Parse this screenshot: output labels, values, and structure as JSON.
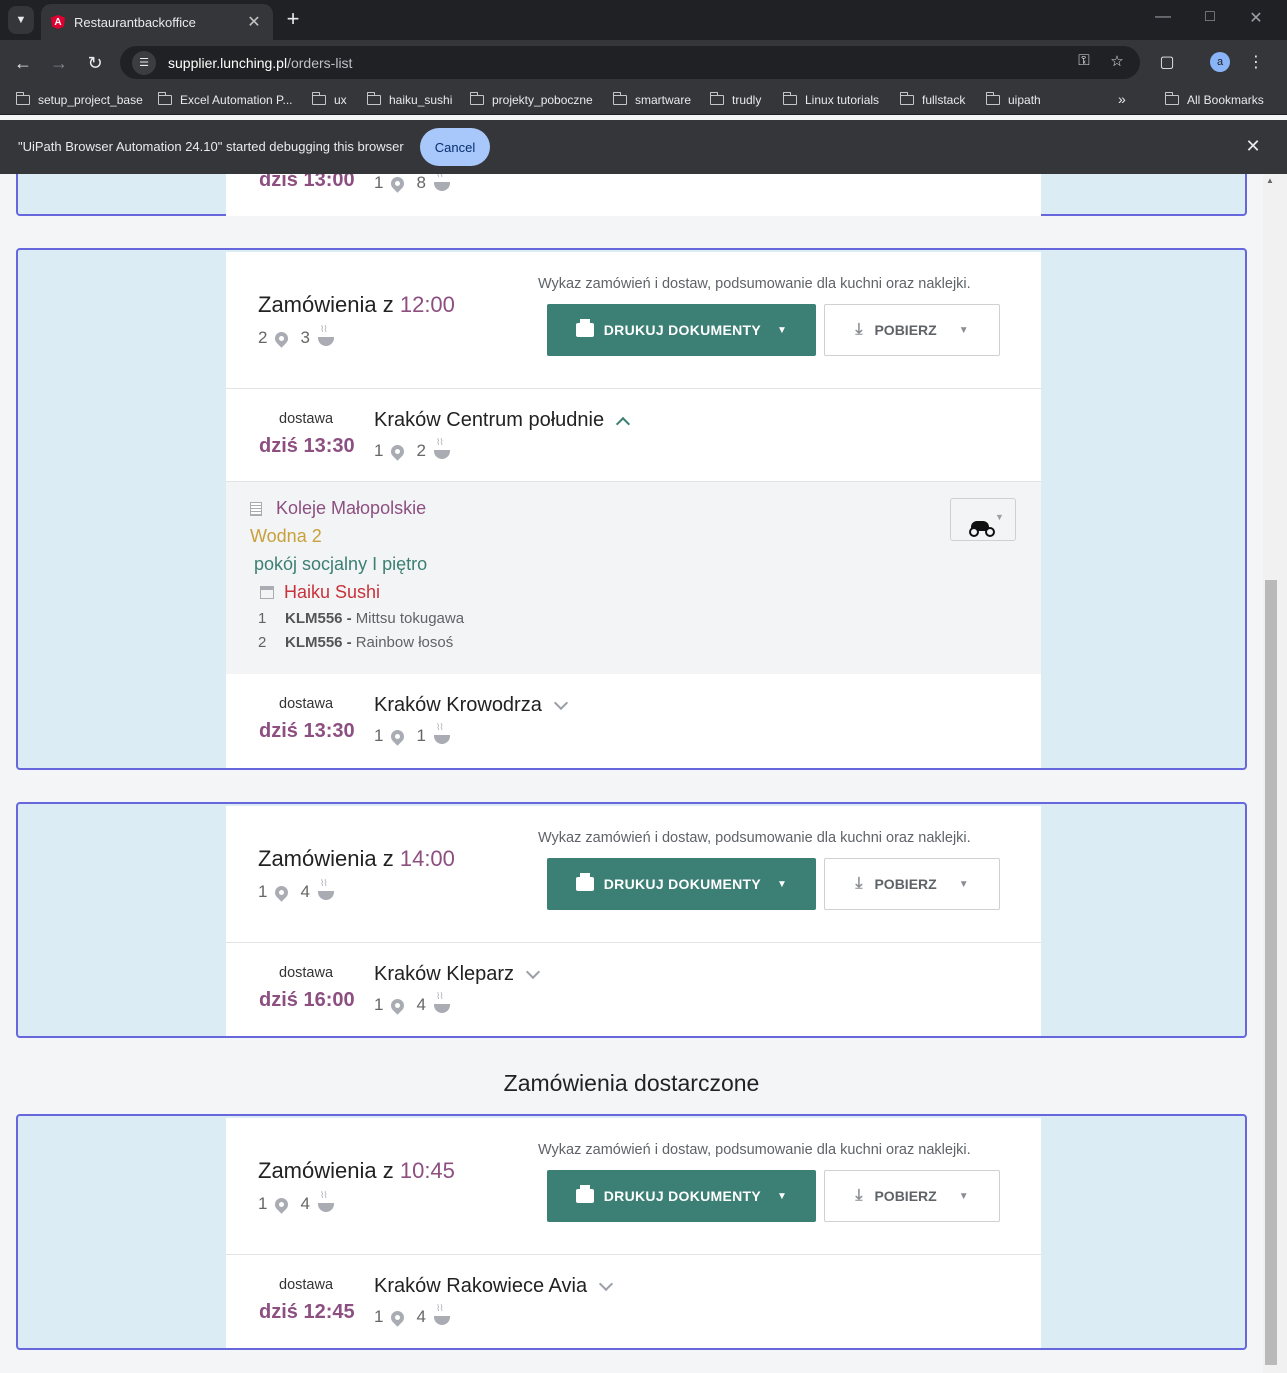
{
  "browser": {
    "tab_title": "Restaurantbackoffice",
    "tab_favicon": "A",
    "url_host": "supplier.lunching.pl",
    "url_path": "/orders-list",
    "avatar_letter": "a",
    "bookmarks": [
      "setup_project_base",
      "Excel Automation P...",
      "ux",
      "haiku_sushi",
      "projekty_poboczne",
      "smartware",
      "trudly",
      "Linux tutorials",
      "fullstack",
      "uipath"
    ],
    "all_bookmarks": "All Bookmarks",
    "more_bookmarks": "»",
    "infobar_text": "\"UiPath Browser Automation 24.10\" started debugging this browser",
    "infobar_cancel": "Cancel"
  },
  "common": {
    "desc": "Wykaz zamówień i dostaw, podsumowanie dla kuchni oraz naklejki.",
    "print_label": "DRUKUJ DOKUMENTY",
    "download_label": "POBIERZ",
    "title_prefix": "Zamówienia z",
    "delivery_label": "dostawa"
  },
  "top_partial": {
    "time": "dziś 13:00",
    "locations": "1",
    "meals": "8"
  },
  "group_1200": {
    "time": "12:00",
    "locations": "2",
    "meals": "3",
    "deliveries": [
      {
        "time": "dziś 13:30",
        "name": "Kraków Centrum południe",
        "locations": "1",
        "meals": "2"
      },
      {
        "time": "dziś 13:30",
        "name": "Kraków Krowodrza",
        "locations": "1",
        "meals": "1"
      }
    ],
    "expanded": {
      "company": "Koleje Małopolskie",
      "street": "Wodna 2",
      "room": "pokój socjalny I piętro",
      "restaurant": "Haiku Sushi",
      "items": [
        {
          "qty": "1",
          "code": "KLM556 -",
          "name": "Mittsu tokugawa"
        },
        {
          "qty": "2",
          "code": "KLM556 -",
          "name": "Rainbow łosoś"
        }
      ]
    }
  },
  "group_1400": {
    "time": "14:00",
    "locations": "1",
    "meals": "4",
    "deliveries": [
      {
        "time": "dziś 16:00",
        "name": "Kraków Kleparz",
        "locations": "1",
        "meals": "4"
      }
    ]
  },
  "delivered_title": "Zamówienia dostarczone",
  "group_1045": {
    "time": "10:45",
    "locations": "1",
    "meals": "4",
    "deliveries": [
      {
        "time": "dziś 12:45",
        "name": "Kraków Rakowiece Avia",
        "locations": "1",
        "meals": "4"
      }
    ]
  }
}
